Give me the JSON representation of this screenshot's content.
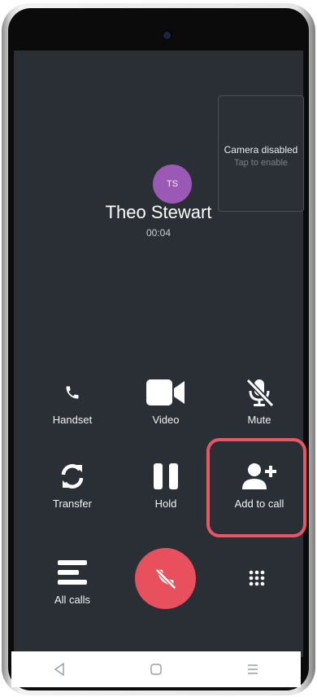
{
  "camera_preview": {
    "title": "Camera disabled",
    "subtitle": "Tap to enable"
  },
  "caller": {
    "initials": "TS",
    "name": "Theo Stewart",
    "duration": "00:04",
    "avatar_color": "#9b59b6"
  },
  "controls": {
    "handset": {
      "label": "Handset",
      "icon": "handset-icon"
    },
    "video": {
      "label": "Video",
      "icon": "video-camera-icon"
    },
    "mute": {
      "label": "Mute",
      "icon": "microphone-off-icon"
    },
    "transfer": {
      "label": "Transfer",
      "icon": "transfer-icon"
    },
    "hold": {
      "label": "Hold",
      "icon": "pause-icon"
    },
    "add_to_call": {
      "label": "Add to call",
      "icon": "add-person-icon"
    },
    "all_calls": {
      "label": "All calls",
      "icon": "list-icon"
    },
    "keypad": {
      "icon": "keypad-icon"
    },
    "end_call": {
      "icon": "end-call-icon"
    }
  },
  "colors": {
    "screen_background": "#2a2f36",
    "end_call": "#e8505d",
    "highlight": "#e85565"
  },
  "nav_bar": {
    "back": "back-icon",
    "home": "home-icon",
    "recents": "recents-icon"
  }
}
